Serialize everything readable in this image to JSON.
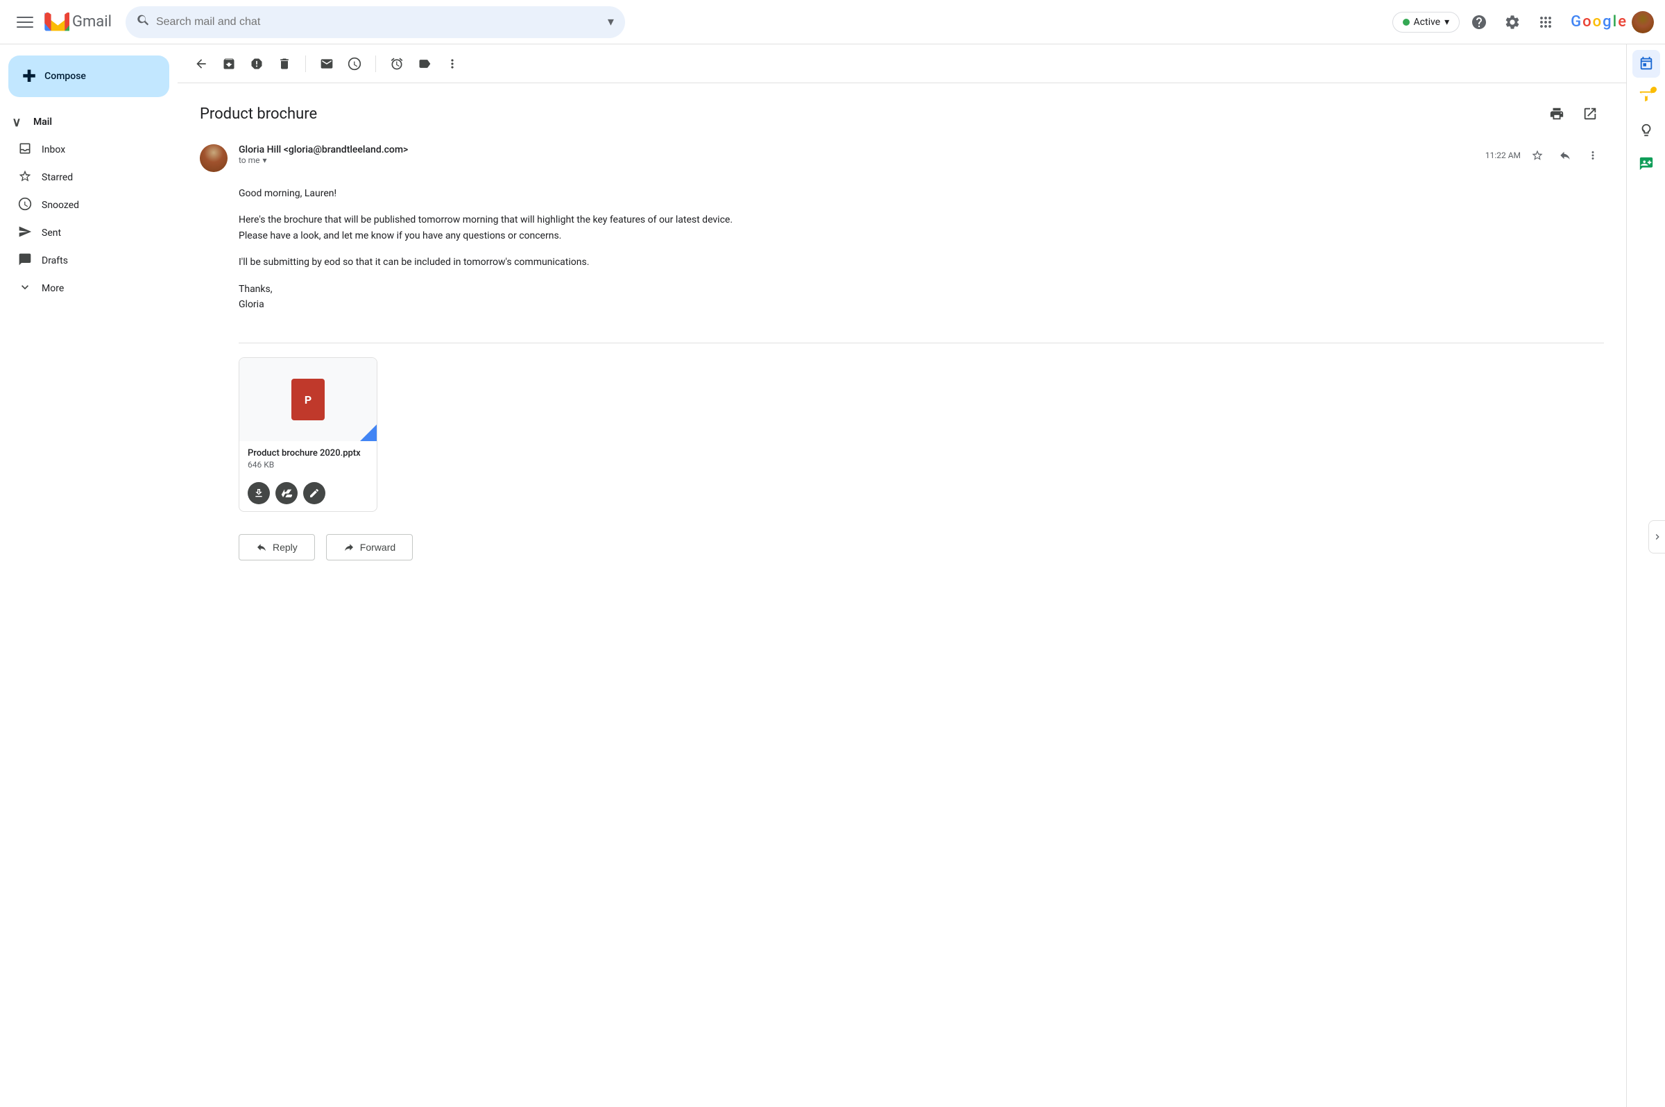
{
  "topbar": {
    "menu_label": "Main menu",
    "app_name": "Gmail",
    "search_placeholder": "Search mail and chat",
    "active_label": "Active",
    "help_label": "Help",
    "settings_label": "Settings",
    "apps_label": "Google apps",
    "google_logo": "Google",
    "active_dropdown": "▾"
  },
  "sidebar": {
    "compose_label": "Compose",
    "mail_section": "Mail",
    "nav_items": [
      {
        "id": "inbox",
        "label": "Inbox",
        "icon": "☐"
      },
      {
        "id": "starred",
        "label": "Starred",
        "icon": "☆"
      },
      {
        "id": "snoozed",
        "label": "Snoozed",
        "icon": "🕐"
      },
      {
        "id": "sent",
        "label": "Sent",
        "icon": "▷"
      },
      {
        "id": "drafts",
        "label": "Drafts",
        "icon": "📄"
      },
      {
        "id": "more",
        "label": "More",
        "icon": "∨"
      }
    ]
  },
  "toolbar": {
    "back_label": "Back",
    "archive_label": "Archive",
    "report_spam_label": "Report spam",
    "delete_label": "Delete",
    "mark_unread_label": "Mark as unread",
    "snooze_label": "Snooze",
    "move_label": "Move to",
    "labels_label": "Labels",
    "more_label": "More"
  },
  "email": {
    "subject": "Product brochure",
    "print_label": "Print",
    "open_new_label": "Open in new window",
    "sender_name": "Gloria Hill",
    "sender_email": "gloria@brandtleeland.com",
    "sender_full": "Gloria Hill <gloria@brandtleeland.com>",
    "to_label": "to me",
    "time": "11:22 AM",
    "star_label": "Star",
    "reply_label": "Reply",
    "more_label": "More",
    "body_lines": [
      "Good morning, Lauren!",
      "",
      "Here's the brochure that will be published tomorrow morning that will highlight the key features of our latest device.",
      "Please have a look, and let me know if you have any questions or concerns.",
      "",
      "I'll be submitting by eod so that it can be included in tomorrow's communications.",
      "",
      "Thanks,",
      "Gloria"
    ],
    "attachment": {
      "name": "Product brochure 2020.pptx",
      "size": "646 KB",
      "icon": "P",
      "download_label": "Download",
      "save_drive_label": "Save to Drive",
      "edit_label": "Edit"
    },
    "reply_button": "Reply",
    "forward_button": "Forward"
  },
  "right_panel": {
    "calendar_label": "Google Calendar",
    "tasks_label": "Google Tasks",
    "keep_label": "Google Keep",
    "contacts_label": "Google Contacts"
  }
}
